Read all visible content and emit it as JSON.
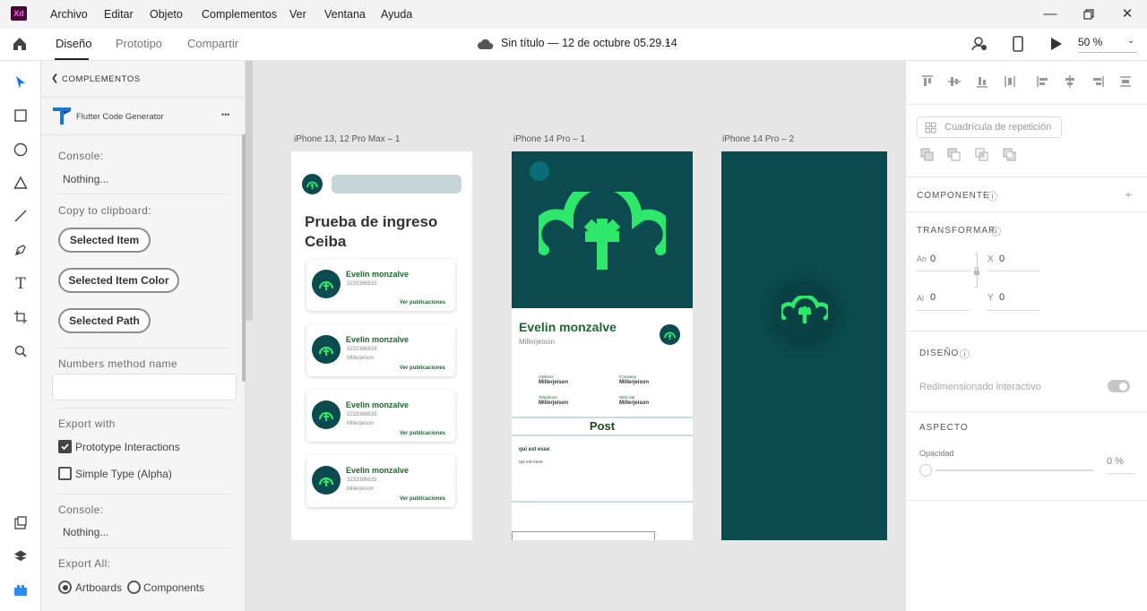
{
  "app": {
    "logo_text": "Xd",
    "accent": "#470137"
  },
  "menubar": [
    "Archivo",
    "Editar",
    "Objeto",
    "Complementos",
    "Ver",
    "Ventana",
    "Ayuda"
  ],
  "toolbar": {
    "tabs": [
      "Diseño",
      "Prototipo",
      "Compartir"
    ],
    "doc_title": "Sin título — 12 de octubre 05.29.14",
    "zoom": "50 %"
  },
  "plugin": {
    "back_label": "COMPLEMENTOS",
    "name": "Flutter Code Generator",
    "more": "•••",
    "console1_label": "Console:",
    "console1_value": "Nothing...",
    "clipboard_label": "Copy to clipboard:",
    "btn_item": "Selected Item",
    "btn_color": "Selected Item Color",
    "btn_path": "Selected Path",
    "numbers_label": "Numbers method name",
    "numbers_value": "",
    "export_with_label": "Export with",
    "opt_proto": "Prototype Interactions",
    "opt_simple": "Simple Type (Alpha)",
    "console2_label": "Console:",
    "console2_value": "Nothing...",
    "export_all_label": "Export All:",
    "radio_artboards": "Artboards",
    "radio_components": "Components"
  },
  "artboards": {
    "a1_label": "iPhone 13, 12 Pro Max – 1",
    "a2_label": "iPhone 14 Pro – 1",
    "a3_label": "iPhone 14 Pro – 2",
    "a1_title": "Prueba de ingreso Ceiba",
    "cards": [
      {
        "name": "Evelin monzalve",
        "phone": "3233386633",
        "sub": "",
        "link": "Ver publicaciones"
      },
      {
        "name": "Evelin monzalve",
        "phone": "3233386633",
        "sub": "Millerjeison",
        "link": "Ver publicaciones"
      },
      {
        "name": "Evelin monzalve",
        "phone": "3233386633",
        "sub": "Millerjeison",
        "link": "Ver publicaciones"
      },
      {
        "name": "Evelin monzalve",
        "phone": "3233386633",
        "sub": "Millerjeison",
        "link": "Ver publicaciones"
      }
    ],
    "a2_name": "Evelin monzalve",
    "a2_user": "Millerjeison",
    "a2_fields": [
      {
        "label": "Address",
        "value": "Millerjeison"
      },
      {
        "label": "Company",
        "value": "Millerjeison"
      },
      {
        "label": "Telephone",
        "value": "Millerjeison"
      },
      {
        "label": "Web site",
        "value": "Millerjeison"
      }
    ],
    "a2_post_title": "Post",
    "a2_post_head": "qui est esse",
    "a2_post_body": "qui est esse",
    "brand_dark": "#0b4b4f",
    "brand_green": "#2ee86b"
  },
  "right": {
    "repeat_grid": "Cuadrícula de repetición",
    "componente": "COMPONENTE",
    "transformar": "TRANSFORMAR",
    "w_label": "An",
    "w_value": "0",
    "h_label": "Al",
    "h_value": "0",
    "x_label": "X",
    "x_value": "0",
    "y_label": "Y",
    "y_value": "0",
    "diseno": "DISEÑO",
    "resize_label": "Redimensionado interactivo",
    "aspecto": "ASPECTO",
    "opacity_label": "Opacidad",
    "opacity_value": "0 %"
  }
}
